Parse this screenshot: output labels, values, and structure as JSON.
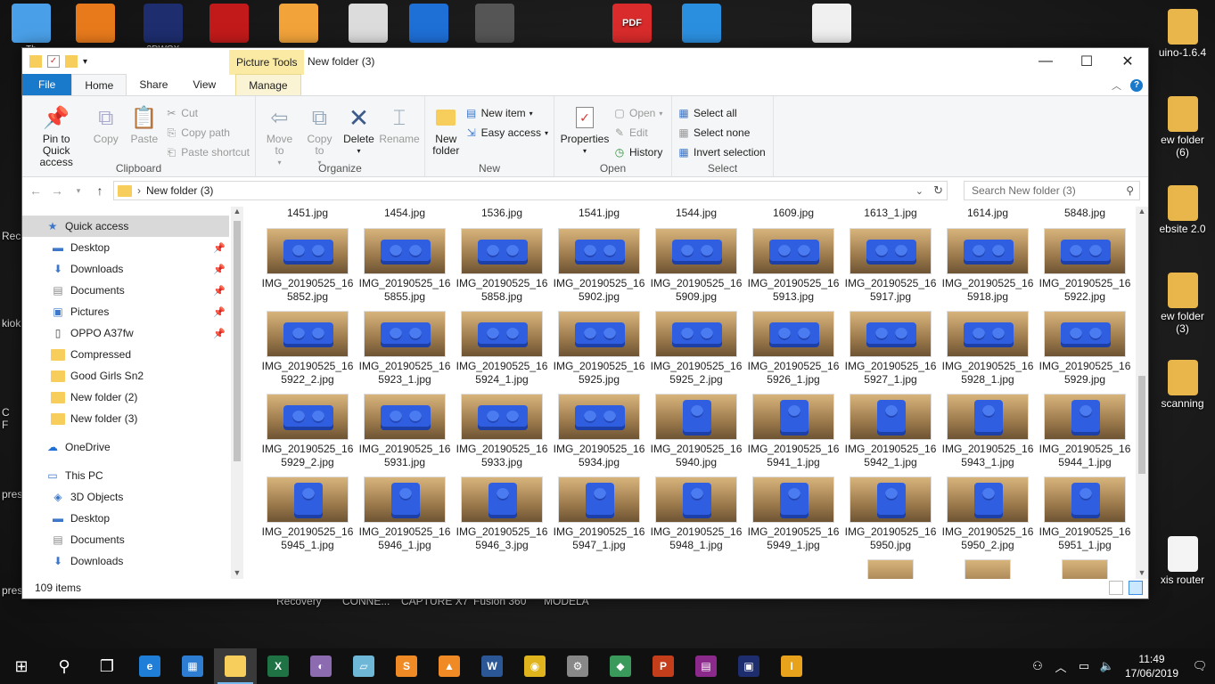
{
  "desktop": {
    "icons_top": [
      {
        "label": "Th",
        "icon": "computer-icon",
        "color": "#4aa0e8"
      },
      {
        "label": "",
        "icon": "app-e-icon",
        "color": "#e87a1c"
      },
      {
        "label": "3DWOX\nSindoh",
        "icon": "3dwox-icon",
        "color": "#1d2d6e"
      },
      {
        "label": "",
        "icon": "software-icon",
        "color": "#c21a1a"
      },
      {
        "label": "",
        "icon": "cura-icon",
        "color": "#f2a33a"
      },
      {
        "label": "",
        "icon": "document-icon",
        "color": "#dcdcdc"
      },
      {
        "label": "",
        "icon": "paint-icon",
        "color": "#1e6fd6"
      },
      {
        "label": "",
        "icon": "installer-icon",
        "color": "#555555"
      },
      {
        "label": "PDF",
        "icon": "pdf-icon",
        "color": "#d92b2b"
      },
      {
        "label": "",
        "icon": "globe-icon",
        "color": "#2b8fe0"
      },
      {
        "label": "",
        "icon": "blank-file-icon",
        "color": "#f0f0f0"
      }
    ],
    "right_icons": [
      {
        "label": "uino-1.6.4"
      },
      {
        "label": "ew folder\n(6)"
      },
      {
        "label": "ebsite 2.0"
      },
      {
        "label": "ew folder\n(3)"
      },
      {
        "label": "scanning"
      },
      {
        "label": "xis router"
      }
    ],
    "left_labels": [
      "Rec",
      "kiok",
      "C\nF",
      "prese",
      "prese"
    ],
    "behind_labels": [
      "Recovery",
      "CONNE...",
      "CAPTURE X7",
      "Fusion 360",
      "MODELA"
    ]
  },
  "window": {
    "qat_title": "New folder (3)",
    "context_tab": "Picture Tools",
    "tabs": [
      "File",
      "Home",
      "Share",
      "View",
      "Manage"
    ],
    "ribbon": {
      "clipboard": {
        "name": "Clipboard",
        "pin": "Pin to Quick access",
        "copy": "Copy",
        "paste": "Paste",
        "cut": "Cut",
        "copy_path": "Copy path",
        "paste_shortcut": "Paste shortcut"
      },
      "organize": {
        "name": "Organize",
        "move_to": "Move to",
        "copy_to": "Copy to",
        "delete": "Delete",
        "rename": "Rename"
      },
      "new": {
        "name": "New",
        "new_folder": "New folder",
        "new_item": "New item",
        "easy_access": "Easy access"
      },
      "open": {
        "name": "Open",
        "properties": "Properties",
        "open": "Open",
        "edit": "Edit",
        "history": "History"
      },
      "select": {
        "name": "Select",
        "select_all": "Select all",
        "select_none": "Select none",
        "invert": "Invert selection"
      }
    },
    "address": {
      "path": "New folder (3)",
      "search_placeholder": "Search New folder (3)"
    },
    "nav": [
      {
        "label": "Quick access",
        "icon": "star-icon",
        "type": "header",
        "selected": true
      },
      {
        "label": "Desktop",
        "icon": "desktop-icon",
        "pinned": true
      },
      {
        "label": "Downloads",
        "icon": "download-icon",
        "pinned": true
      },
      {
        "label": "Documents",
        "icon": "documents-icon",
        "pinned": true
      },
      {
        "label": "Pictures",
        "icon": "pictures-icon",
        "pinned": true
      },
      {
        "label": "OPPO A37fw",
        "icon": "phone-icon",
        "pinned": true
      },
      {
        "label": "Compressed",
        "icon": "folder-icon"
      },
      {
        "label": "Good Girls Sn2",
        "icon": "folder-icon"
      },
      {
        "label": "New folder (2)",
        "icon": "folder-icon"
      },
      {
        "label": "New folder (3)",
        "icon": "folder-icon"
      },
      {
        "label": "OneDrive",
        "icon": "onedrive-icon",
        "type": "header"
      },
      {
        "label": "This PC",
        "icon": "pc-icon",
        "type": "header"
      },
      {
        "label": "3D Objects",
        "icon": "3d-objects-icon"
      },
      {
        "label": "Desktop",
        "icon": "desktop-icon"
      },
      {
        "label": "Documents",
        "icon": "documents-icon"
      },
      {
        "label": "Downloads",
        "icon": "download-icon"
      }
    ],
    "top_row_names": [
      "1451.jpg",
      "1454.jpg",
      "1536.jpg",
      "1541.jpg",
      "1544.jpg",
      "1609.jpg",
      "1613_1.jpg",
      "1614.jpg",
      "5848.jpg"
    ],
    "files": [
      [
        "IMG_20190525_16",
        "5852.jpg"
      ],
      [
        "IMG_20190525_16",
        "5855.jpg"
      ],
      [
        "IMG_20190525_16",
        "5858.jpg"
      ],
      [
        "IMG_20190525_16",
        "5902.jpg"
      ],
      [
        "IMG_20190525_16",
        "5909.jpg"
      ],
      [
        "IMG_20190525_16",
        "5913.jpg"
      ],
      [
        "IMG_20190525_16",
        "5917.jpg"
      ],
      [
        "IMG_20190525_16",
        "5918.jpg"
      ],
      [
        "IMG_20190525_16",
        "5922.jpg"
      ],
      [
        "IMG_20190525_16",
        "5922_2.jpg"
      ],
      [
        "IMG_20190525_16",
        "5923_1.jpg"
      ],
      [
        "IMG_20190525_16",
        "5924_1.jpg"
      ],
      [
        "IMG_20190525_16",
        "5925.jpg"
      ],
      [
        "IMG_20190525_16",
        "5925_2.jpg"
      ],
      [
        "IMG_20190525_16",
        "5926_1.jpg"
      ],
      [
        "IMG_20190525_16",
        "5927_1.jpg"
      ],
      [
        "IMG_20190525_16",
        "5928_1.jpg"
      ],
      [
        "IMG_20190525_16",
        "5929.jpg"
      ],
      [
        "IMG_20190525_16",
        "5929_2.jpg"
      ],
      [
        "IMG_20190525_16",
        "5931.jpg"
      ],
      [
        "IMG_20190525_16",
        "5933.jpg"
      ],
      [
        "IMG_20190525_16",
        "5934.jpg"
      ],
      [
        "IMG_20190525_16",
        "5940.jpg"
      ],
      [
        "IMG_20190525_16",
        "5941_1.jpg"
      ],
      [
        "IMG_20190525_16",
        "5942_1.jpg"
      ],
      [
        "IMG_20190525_16",
        "5943_1.jpg"
      ],
      [
        "IMG_20190525_16",
        "5944_1.jpg"
      ],
      [
        "IMG_20190525_16",
        "5945_1.jpg"
      ],
      [
        "IMG_20190525_16",
        "5946_1.jpg"
      ],
      [
        "IMG_20190525_16",
        "5946_3.jpg"
      ],
      [
        "IMG_20190525_16",
        "5947_1.jpg"
      ],
      [
        "IMG_20190525_16",
        "5948_1.jpg"
      ],
      [
        "IMG_20190525_16",
        "5949_1.jpg"
      ],
      [
        "IMG_20190525_16",
        "5950.jpg"
      ],
      [
        "IMG_20190525_16",
        "5950_2.jpg"
      ],
      [
        "IMG_20190525_16",
        "5951_1.jpg"
      ]
    ],
    "status": "109 items"
  },
  "taskbar": {
    "apps": [
      {
        "icon": "start-icon",
        "color": "#101010",
        "label": ""
      },
      {
        "icon": "search-icon",
        "color": "#101010",
        "label": ""
      },
      {
        "icon": "task-view-icon",
        "color": "#101010",
        "label": ""
      },
      {
        "icon": "edge-icon",
        "color": "#1f7fd8",
        "label": "e"
      },
      {
        "icon": "store-icon",
        "color": "#2d7dd2",
        "label": ""
      },
      {
        "icon": "file-explorer-icon",
        "color": "#f7cd5b",
        "label": "",
        "active": true
      },
      {
        "icon": "excel-icon",
        "color": "#1f7244",
        "label": "X"
      },
      {
        "icon": "paint-icon",
        "color": "#8c6bb1",
        "label": ""
      },
      {
        "icon": "notepad-icon",
        "color": "#6fb7d6",
        "label": ""
      },
      {
        "icon": "sublime-icon",
        "color": "#f08a24",
        "label": "S"
      },
      {
        "icon": "vlc-icon",
        "color": "#f08a24",
        "label": ""
      },
      {
        "icon": "word-icon",
        "color": "#2b5797",
        "label": "W"
      },
      {
        "icon": "chrome-icon",
        "color": "#e0b41c",
        "label": ""
      },
      {
        "icon": "settings-tool-icon",
        "color": "#888888",
        "label": ""
      },
      {
        "icon": "git-icon",
        "color": "#3a9a5b",
        "label": ""
      },
      {
        "icon": "powerpoint-icon",
        "color": "#c43e1c",
        "label": "P"
      },
      {
        "icon": "winrar-icon",
        "color": "#8b2a8b",
        "label": ""
      },
      {
        "icon": "3dwox-icon",
        "color": "#1d2d6e",
        "label": ""
      },
      {
        "icon": "inkscape-icon",
        "color": "#e8a21c",
        "label": "I"
      }
    ],
    "time": "11:49",
    "date": "17/06/2019"
  }
}
